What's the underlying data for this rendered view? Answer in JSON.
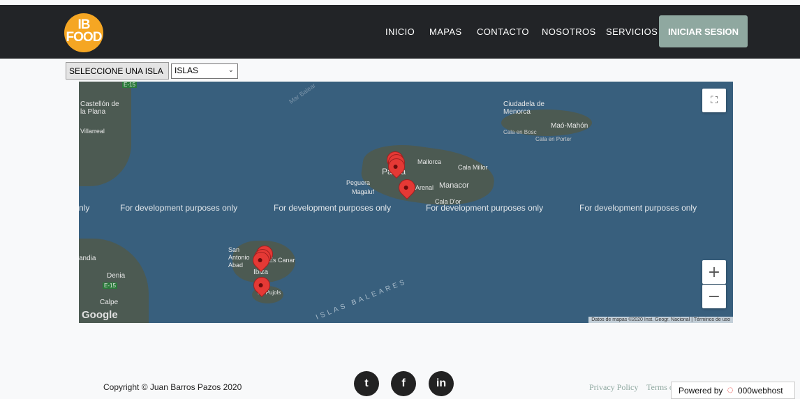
{
  "header": {
    "logo_line1": "IB",
    "logo_line2": "FOOD",
    "nav": [
      "INICIO",
      "MAPAS",
      "CONTACTO",
      "NOSOTROS",
      "SERVICIOS"
    ],
    "login_label": "INICIAR SESION"
  },
  "selector": {
    "label": "SELECCIONE UNA ISLA",
    "value": "ISLAS"
  },
  "map": {
    "dev_text": "For development purposes only",
    "dev_text_partial": "nly",
    "labels": {
      "castellon": "Castellón de la Plana",
      "villarreal": "Villarreal",
      "ciudadela": "Ciudadela de Menorca",
      "mahon": "Maó-Mahón",
      "cala_bosc": "Cala en Bosc",
      "cala_porter": "Cala en Porter",
      "mallorca": "Mallorca",
      "palma": "Palma",
      "cala_millor": "Cala Millor",
      "peguera": "Peguera",
      "magaluf": "Magaluf",
      "arenal": "Arenal",
      "manacor": "Manacor",
      "cala_dor": "Cala D'or",
      "san_antonio": "San Antonio Abad",
      "es_canar": "Es Canar",
      "ibiza": "Ibiza",
      "denia": "Denia",
      "calpe": "Calpe",
      "formentera": "Es Pujols",
      "islas_baleares": "ISLAS BALEARES",
      "mar_balear": "Mar Balear",
      "gandia": "andia",
      "road1": "E-15",
      "road2": "E-15"
    },
    "google": "Google",
    "attribution": "Datos de mapas ©2020 Inst. Geogr. Nacional",
    "terms": "Términos de uso",
    "fullscreen_icon": "fullscreen-icon",
    "zoom_in": "+",
    "zoom_out": "−"
  },
  "footer": {
    "copyright": "Copyright © Juan Barros Pazos 2020",
    "social": [
      {
        "icon": "twitter-icon",
        "glyph": "t"
      },
      {
        "icon": "facebook-icon",
        "glyph": "f"
      },
      {
        "icon": "linkedin-icon",
        "glyph": "in"
      }
    ],
    "privacy": "Privacy Policy",
    "terms": "Terms of Use",
    "powered_by": "Powered by",
    "host": "000webhost"
  }
}
